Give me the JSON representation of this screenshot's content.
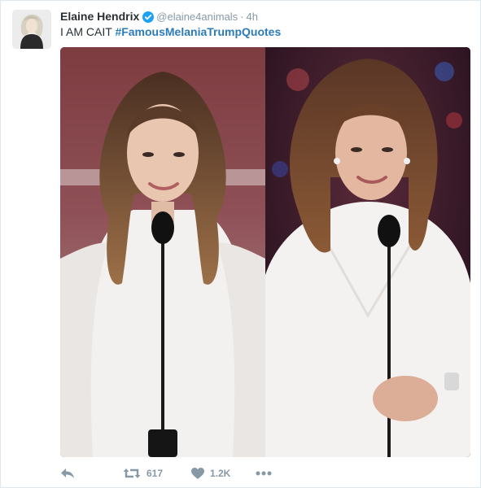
{
  "author": {
    "name": "Elaine Hendrix",
    "handle": "@elaine4animals",
    "time": "4h",
    "verified": true
  },
  "tweet": {
    "text": "I AM CAIT",
    "hashtag": "#FamousMelaniaTrumpQuotes"
  },
  "actions": {
    "reply_icon": "reply-icon",
    "retweet_icon": "retweet-icon",
    "retweet_count": "617",
    "like_icon": "heart-icon",
    "like_count": "1.2K",
    "more_icon": "more-icon"
  },
  "colors": {
    "link": "#2b7bb9",
    "muted": "#8899a6",
    "text": "#292f33",
    "verified": "#1da1f2"
  }
}
